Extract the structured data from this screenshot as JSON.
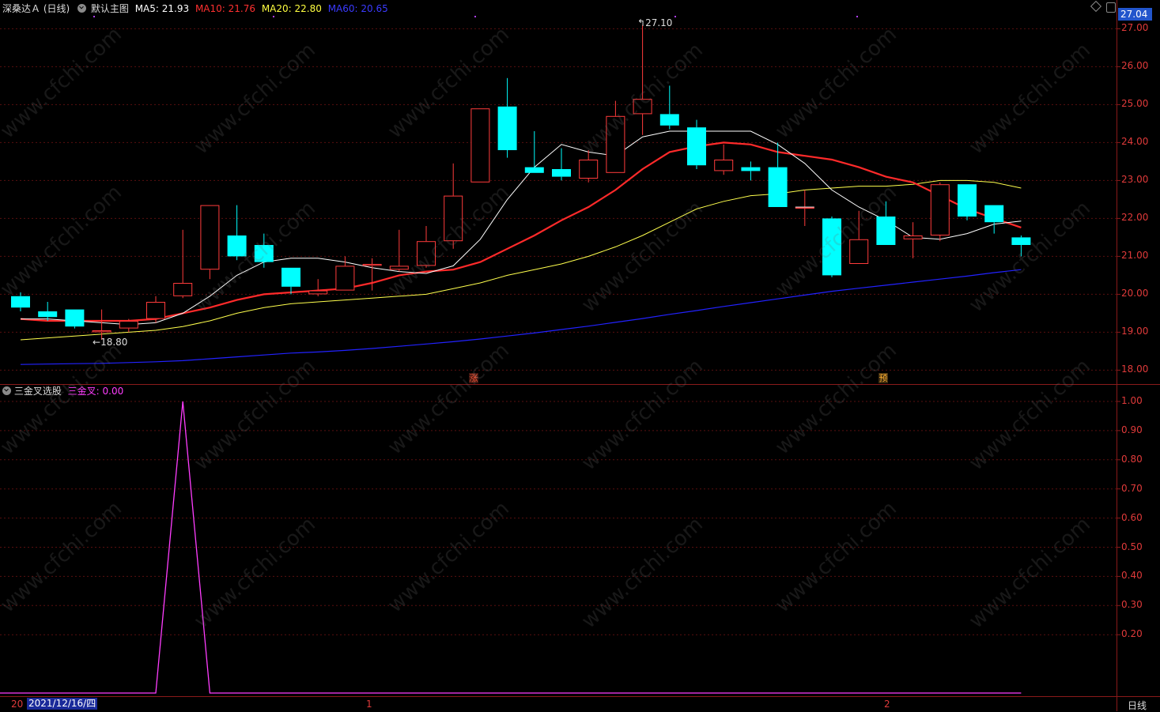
{
  "header": {
    "stock_name": "深桑达Ａ (日线)",
    "template": "默认主图",
    "ma5": "MA5: 21.93",
    "ma10": "MA10: 21.76",
    "ma20": "MA20: 22.80",
    "ma60": "MA60: 20.65",
    "current_price": "27.04"
  },
  "indicator": {
    "name": "三金叉选股",
    "value_label": "三金叉: 0.00"
  },
  "price_axis": [
    "27.00",
    "26.00",
    "25.00",
    "24.00",
    "23.00",
    "22.00",
    "21.00",
    "20.00",
    "19.00",
    "18.00"
  ],
  "indicator_axis": [
    "1.00",
    "0.90",
    "0.80",
    "0.70",
    "0.60",
    "0.50",
    "0.40",
    "0.30",
    "0.20"
  ],
  "annotations": {
    "high": "27.10",
    "low": "18.80",
    "marker_zhang": "涨",
    "marker_yu": "预"
  },
  "bottom_bar": {
    "year_prefix": "20",
    "cursor_date": "2021/12/16/四",
    "month_1": "1",
    "month_2": "2",
    "period": "日线"
  },
  "watermark": "www.cfchi.com",
  "colors": {
    "up": "#ff3b3b",
    "down": "#00ffff",
    "ma5": "#ffffff",
    "ma10": "#ff2a2a",
    "ma20": "#ffff4d",
    "ma60": "#2222ff",
    "indicator": "#ff3dff"
  },
  "chart_data": {
    "type": "candlestick",
    "candles": [
      {
        "o": 19.95,
        "h": 20.05,
        "l": 19.55,
        "c": 19.65
      },
      {
        "o": 19.55,
        "h": 19.8,
        "l": 19.3,
        "c": 19.4
      },
      {
        "o": 19.6,
        "h": 19.6,
        "l": 19.1,
        "c": 19.15
      },
      {
        "o": 19.0,
        "h": 19.6,
        "l": 18.8,
        "c": 19.05
      },
      {
        "o": 19.1,
        "h": 19.35,
        "l": 19.0,
        "c": 19.3
      },
      {
        "o": 19.35,
        "h": 19.95,
        "l": 19.25,
        "c": 19.8
      },
      {
        "o": 19.95,
        "h": 21.7,
        "l": 19.9,
        "c": 20.3
      },
      {
        "o": 20.65,
        "h": 22.35,
        "l": 20.4,
        "c": 22.35
      },
      {
        "o": 21.55,
        "h": 22.35,
        "l": 20.9,
        "c": 21.0
      },
      {
        "o": 21.3,
        "h": 21.6,
        "l": 20.7,
        "c": 20.85
      },
      {
        "o": 20.7,
        "h": 20.7,
        "l": 20.0,
        "c": 20.2
      },
      {
        "o": 20.0,
        "h": 20.4,
        "l": 19.95,
        "c": 20.1
      },
      {
        "o": 20.1,
        "h": 21.0,
        "l": 20.1,
        "c": 20.75
      },
      {
        "o": 20.75,
        "h": 20.95,
        "l": 20.1,
        "c": 20.8
      },
      {
        "o": 20.65,
        "h": 21.7,
        "l": 20.6,
        "c": 20.75
      },
      {
        "o": 20.75,
        "h": 21.8,
        "l": 20.7,
        "c": 21.4
      },
      {
        "o": 21.4,
        "h": 23.45,
        "l": 21.2,
        "c": 22.6
      },
      {
        "o": 22.95,
        "h": 24.9,
        "l": 22.95,
        "c": 24.9
      },
      {
        "o": 24.95,
        "h": 25.7,
        "l": 23.6,
        "c": 23.8
      },
      {
        "o": 23.35,
        "h": 24.3,
        "l": 23.2,
        "c": 23.2
      },
      {
        "o": 23.3,
        "h": 23.85,
        "l": 23.0,
        "c": 23.1
      },
      {
        "o": 23.05,
        "h": 23.8,
        "l": 22.95,
        "c": 23.55
      },
      {
        "o": 23.2,
        "h": 25.1,
        "l": 23.2,
        "c": 24.7
      },
      {
        "o": 24.75,
        "h": 27.1,
        "l": 24.2,
        "c": 25.15
      },
      {
        "o": 24.75,
        "h": 25.5,
        "l": 24.35,
        "c": 24.45
      },
      {
        "o": 24.4,
        "h": 24.6,
        "l": 23.3,
        "c": 23.4
      },
      {
        "o": 23.25,
        "h": 23.95,
        "l": 23.15,
        "c": 23.55
      },
      {
        "o": 23.35,
        "h": 23.5,
        "l": 23.0,
        "c": 23.25
      },
      {
        "o": 23.35,
        "h": 24.0,
        "l": 22.3,
        "c": 22.3
      },
      {
        "o": 22.3,
        "h": 22.75,
        "l": 21.8,
        "c": 22.3
      },
      {
        "o": 22.0,
        "h": 22.05,
        "l": 20.45,
        "c": 20.5
      },
      {
        "o": 20.8,
        "h": 22.2,
        "l": 20.8,
        "c": 21.45
      },
      {
        "o": 22.05,
        "h": 22.45,
        "l": 21.3,
        "c": 21.3
      },
      {
        "o": 21.45,
        "h": 21.9,
        "l": 20.95,
        "c": 21.55
      },
      {
        "o": 21.55,
        "h": 22.95,
        "l": 21.4,
        "c": 22.9
      },
      {
        "o": 22.9,
        "h": 22.9,
        "l": 21.95,
        "c": 22.05
      },
      {
        "o": 22.35,
        "h": 22.35,
        "l": 21.6,
        "c": 21.9
      },
      {
        "o": 21.5,
        "h": 21.55,
        "l": 21.0,
        "c": 21.3
      }
    ],
    "ma5": [
      19.35,
      19.35,
      19.3,
      19.25,
      19.2,
      19.25,
      19.5,
      19.95,
      20.5,
      20.85,
      20.95,
      20.95,
      20.85,
      20.7,
      20.6,
      20.55,
      20.75,
      21.45,
      22.5,
      23.35,
      23.95,
      23.75,
      23.65,
      24.15,
      24.3,
      24.3,
      24.3,
      24.3,
      23.95,
      23.45,
      22.75,
      22.3,
      21.95,
      21.5,
      21.45,
      21.6,
      21.85,
      21.93
    ],
    "ma10": [
      19.35,
      19.3,
      19.3,
      19.3,
      19.3,
      19.35,
      19.5,
      19.65,
      19.85,
      20.0,
      20.05,
      20.1,
      20.15,
      20.3,
      20.5,
      20.6,
      20.65,
      20.85,
      21.2,
      21.55,
      21.95,
      22.3,
      22.75,
      23.3,
      23.75,
      23.9,
      24.0,
      23.95,
      23.75,
      23.65,
      23.55,
      23.35,
      23.1,
      22.95,
      22.6,
      22.25,
      22.0,
      21.76
    ],
    "ma20": [
      18.8,
      18.85,
      18.9,
      18.95,
      19.0,
      19.05,
      19.15,
      19.3,
      19.5,
      19.65,
      19.75,
      19.8,
      19.85,
      19.9,
      19.95,
      20.0,
      20.15,
      20.3,
      20.5,
      20.65,
      20.8,
      21.0,
      21.25,
      21.55,
      21.9,
      22.25,
      22.45,
      22.6,
      22.65,
      22.75,
      22.8,
      22.85,
      22.85,
      22.9,
      23.0,
      23.0,
      22.95,
      22.8
    ],
    "ma60": [
      18.15,
      18.16,
      18.17,
      18.18,
      18.2,
      18.22,
      18.25,
      18.3,
      18.35,
      18.4,
      18.45,
      18.48,
      18.52,
      18.57,
      18.63,
      18.69,
      18.75,
      18.82,
      18.9,
      18.98,
      19.07,
      19.16,
      19.26,
      19.36,
      19.47,
      19.57,
      19.68,
      19.78,
      19.88,
      19.98,
      20.08,
      20.16,
      20.24,
      20.32,
      20.4,
      20.48,
      20.57,
      20.65
    ],
    "indicator": [
      0,
      0,
      0,
      0,
      0,
      0,
      1,
      0,
      0,
      0,
      0,
      0,
      0,
      0,
      0,
      0,
      0,
      0,
      0,
      0,
      0,
      0,
      0,
      0,
      0,
      0,
      0,
      0,
      0,
      0,
      0,
      0,
      0,
      0,
      0,
      0,
      0,
      0
    ],
    "price_range": [
      17.8,
      27.3
    ],
    "indicator_range": [
      0,
      1.05
    ]
  }
}
